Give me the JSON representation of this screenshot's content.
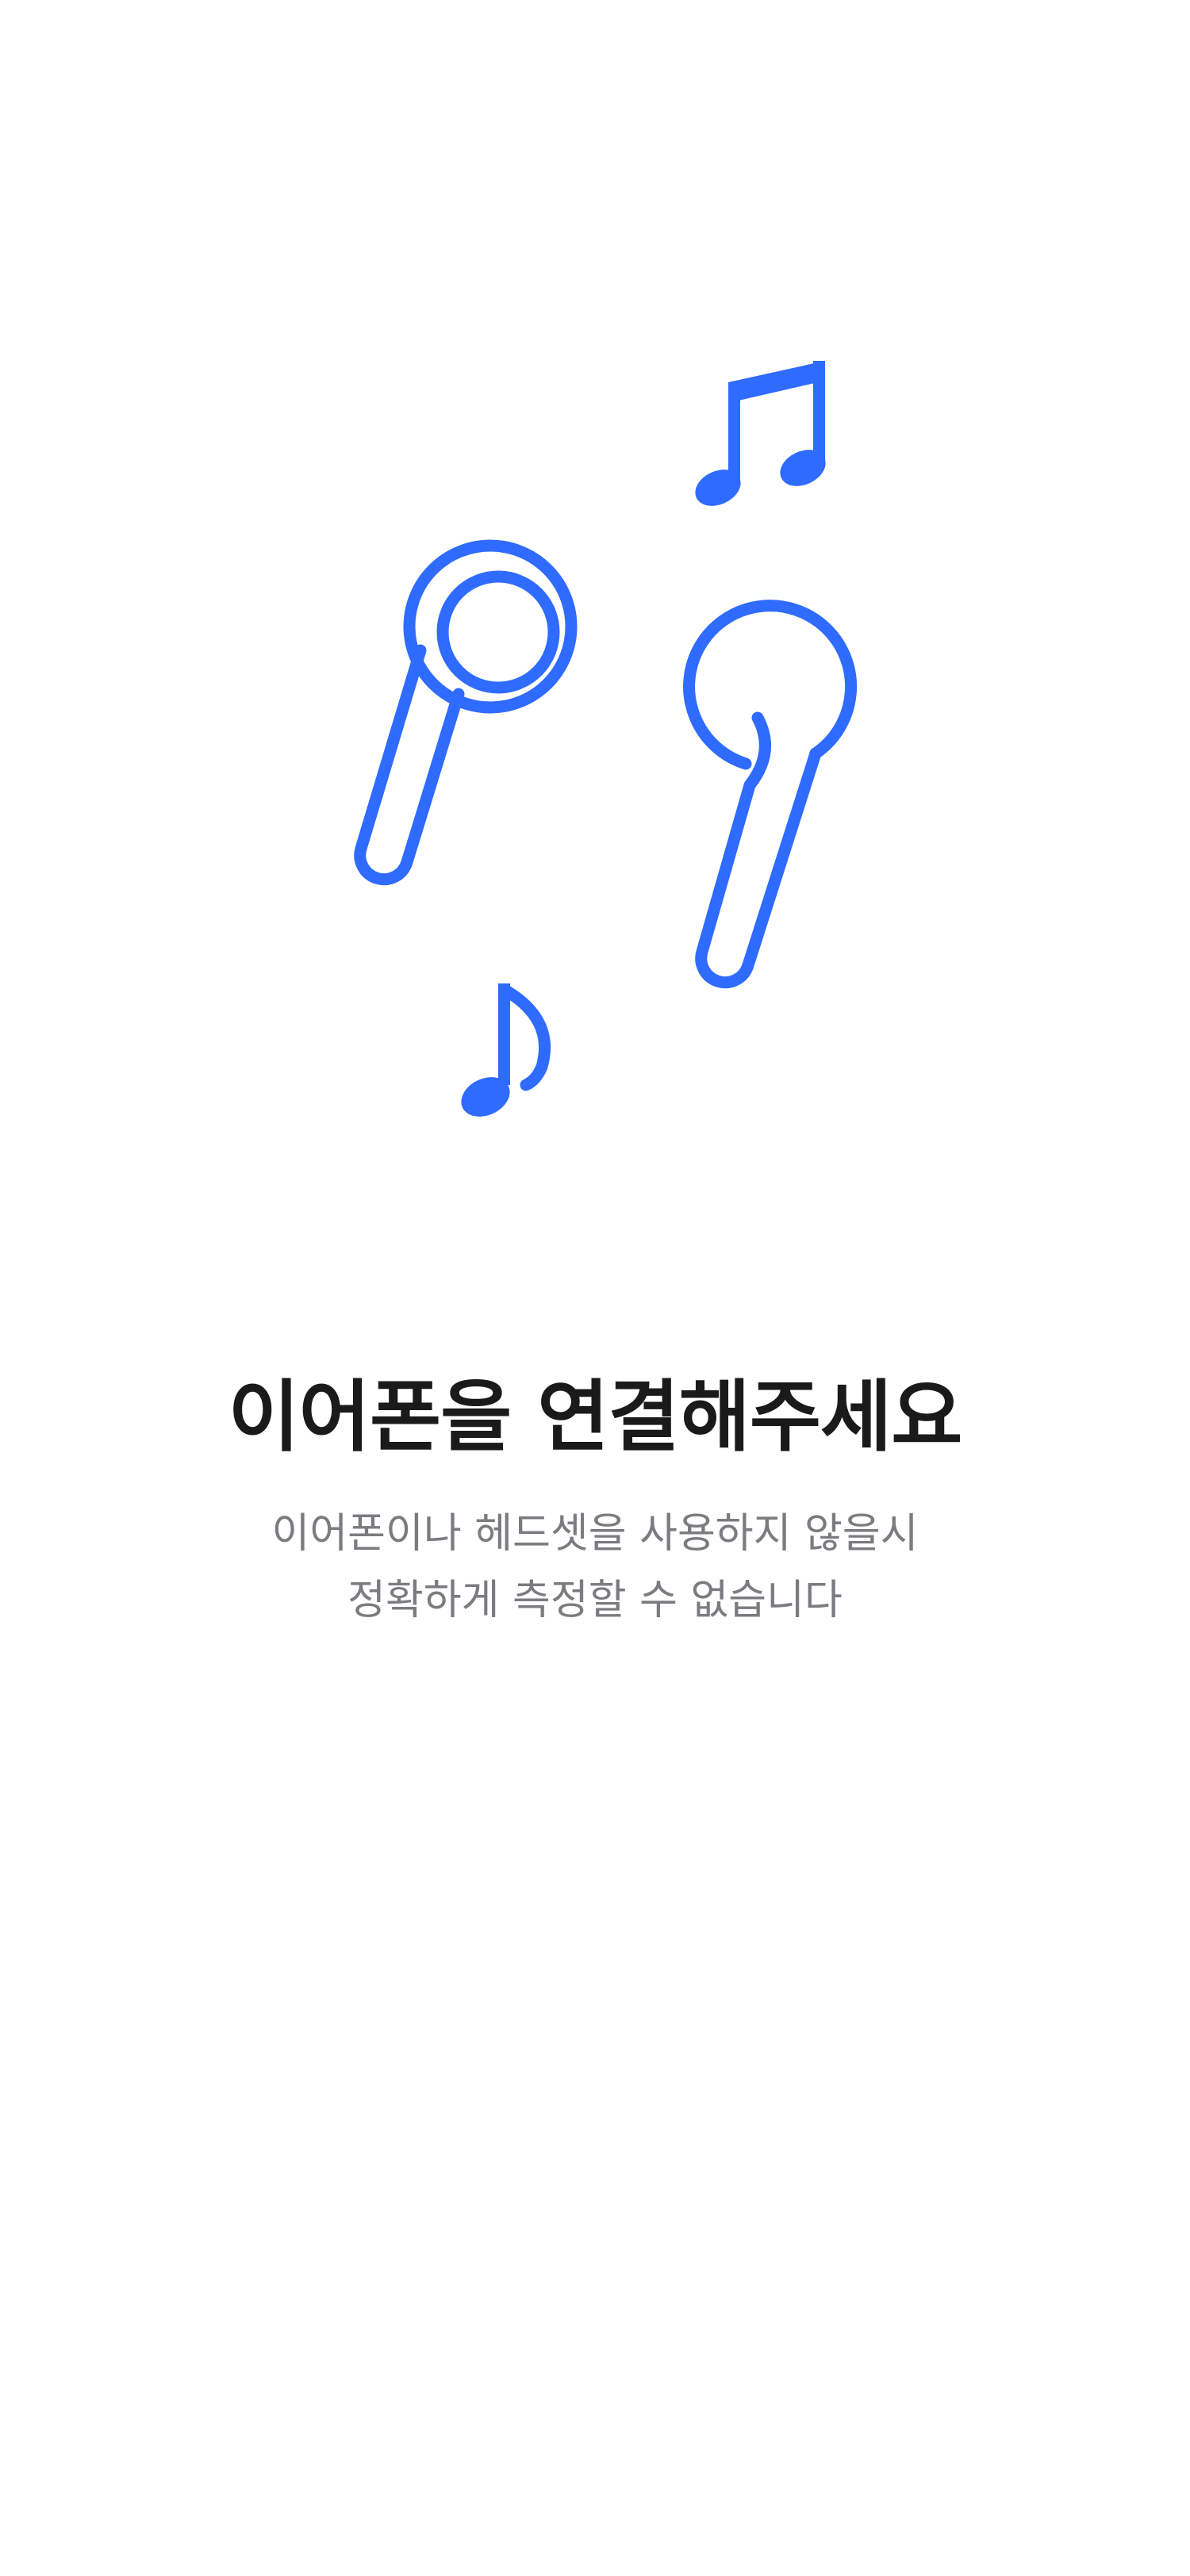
{
  "illustration": {
    "accent_color": "#2f6bff",
    "icons": [
      "earphone-icon",
      "music-note-icon"
    ]
  },
  "content": {
    "title": "이어폰을 연결해주세요",
    "subtitle_lines": [
      "이어폰이나 헤드셋을 사용하지 않을시",
      "정확하게 측정할 수 없습니다"
    ]
  }
}
